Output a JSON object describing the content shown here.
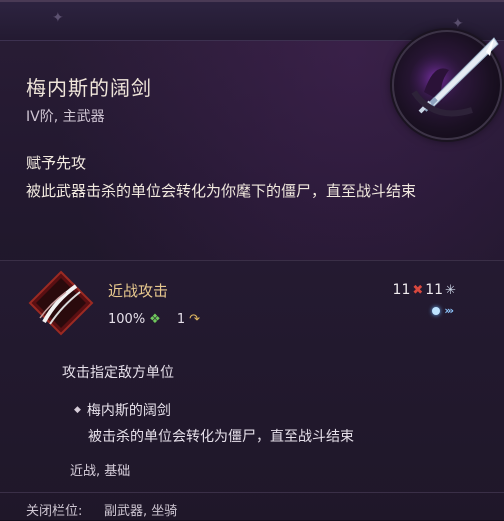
{
  "item": {
    "name": "梅内斯的阔剑",
    "subtitle": "IV阶, 主武器",
    "icon": "mennes-broadsword-icon"
  },
  "perk": {
    "title": "赋予先攻",
    "description": "被此武器击杀的单位会转化为你麾下的僵尸，直至战斗结束"
  },
  "ability": {
    "name": "近战攻击",
    "icon": "melee-slash-icon",
    "accuracy": "100%",
    "ap_cost": "1",
    "damage_min": "11",
    "damage_max": "11",
    "target": "攻击指定敌方单位",
    "bullet_title": "梅内斯的阔剑",
    "bullet_desc": "被击杀的单位会转化为僵尸，直至战斗结束",
    "tags": "近战, 基础"
  },
  "footer": {
    "label": "关闭栏位:",
    "value": "副武器, 坐骑"
  },
  "colors": {
    "accent_gold": "#e8c98e",
    "damage_red": "#d8483e",
    "accuracy_green": "#6fc85c"
  }
}
